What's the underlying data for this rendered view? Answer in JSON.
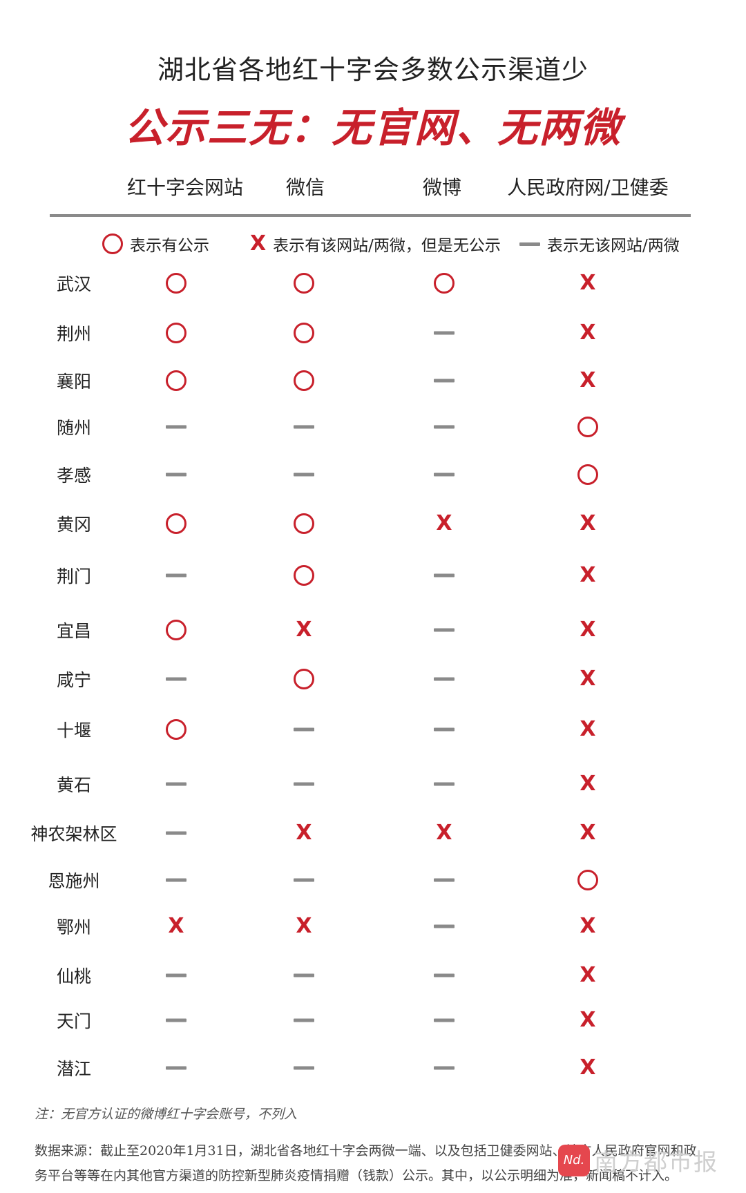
{
  "title": "湖北省各地红十字会多数公示渠道少",
  "subtitle": "公示三无：无官网、无两微",
  "columns": [
    "红十字会网站",
    "微信",
    "微博",
    "人民政府网/卫健委"
  ],
  "legend": {
    "circle": "表示有公示",
    "x": "表示有该网站/两微，但是无公示",
    "dash": "表示无该网站/两微"
  },
  "rows": [
    {
      "name": "武汉",
      "marks": [
        "circle",
        "circle",
        "circle",
        "x"
      ]
    },
    {
      "name": "荆州",
      "marks": [
        "circle",
        "circle",
        "dash",
        "x"
      ]
    },
    {
      "name": "襄阳",
      "marks": [
        "circle",
        "circle",
        "dash",
        "x"
      ]
    },
    {
      "name": "随州",
      "marks": [
        "dash",
        "dash",
        "dash",
        "circle"
      ]
    },
    {
      "name": "孝感",
      "marks": [
        "dash",
        "dash",
        "dash",
        "circle"
      ]
    },
    {
      "name": "黄冈",
      "marks": [
        "circle",
        "circle",
        "x",
        "x"
      ]
    },
    {
      "name": "荆门",
      "marks": [
        "dash",
        "circle",
        "dash",
        "x"
      ]
    },
    {
      "name": "宜昌",
      "marks": [
        "circle",
        "x",
        "dash",
        "x"
      ]
    },
    {
      "name": "咸宁",
      "marks": [
        "dash",
        "circle",
        "dash",
        "x"
      ]
    },
    {
      "name": "十堰",
      "marks": [
        "circle",
        "dash",
        "dash",
        "x"
      ]
    },
    {
      "name": "黄石",
      "marks": [
        "dash",
        "dash",
        "dash",
        "x"
      ]
    },
    {
      "name": "神农架林区",
      "marks": [
        "dash",
        "x",
        "x",
        "x"
      ]
    },
    {
      "name": "恩施州",
      "marks": [
        "dash",
        "dash",
        "dash",
        "circle"
      ]
    },
    {
      "name": "鄂州",
      "marks": [
        "x",
        "x",
        "dash",
        "x"
      ]
    },
    {
      "name": "仙桃",
      "marks": [
        "dash",
        "dash",
        "dash",
        "x"
      ]
    },
    {
      "name": "天门",
      "marks": [
        "dash",
        "dash",
        "dash",
        "x"
      ]
    },
    {
      "name": "潜江",
      "marks": [
        "dash",
        "dash",
        "dash",
        "x"
      ]
    }
  ],
  "x_glyph": "X",
  "note": "注：无官方认证的微博红十字会账号，不列入",
  "source": "数据来源：截止至2020年1月31日，湖北省各地红十字会两微一端、以及包括卫健委网站、地方人民政府官网和政务平台等等在内其他官方渠道的防控新型肺炎疫情捐赠（钱款）公示。其中，以公示明细为准，新闻稿不计入。",
  "watermark": {
    "logo": "Nd.",
    "text": "南方都市报"
  },
  "colors": {
    "accent": "#c8202b",
    "dash": "#8a8a8a",
    "text": "#222222"
  },
  "icons": {
    "circle": "circle-icon",
    "x": "x-icon",
    "dash": "dash-icon"
  }
}
